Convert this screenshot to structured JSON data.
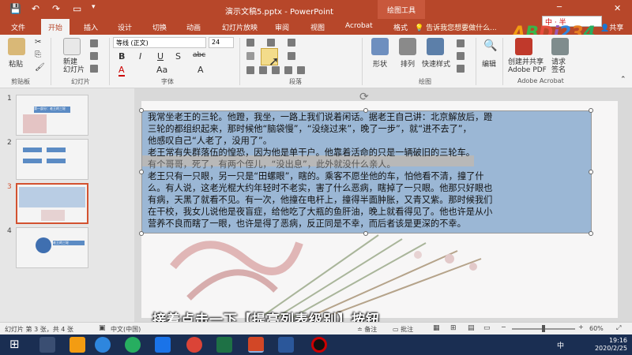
{
  "titlebar": {
    "title": "演示文稿5.pptx - PowerPoint",
    "context_tab": "绘图工具",
    "save_icon": "save-icon",
    "undo_icon": "undo-icon",
    "redo_icon": "redo-icon",
    "present_icon": "present-icon"
  },
  "tabs": [
    {
      "label": "文件"
    },
    {
      "label": "开始"
    },
    {
      "label": "插入"
    },
    {
      "label": "设计"
    },
    {
      "label": "切换"
    },
    {
      "label": "动画"
    },
    {
      "label": "幻灯片放映"
    },
    {
      "label": "审阅"
    },
    {
      "label": "视图"
    },
    {
      "label": "Acrobat"
    },
    {
      "label": "格式"
    }
  ],
  "tellme": "告诉我您想要做什么...",
  "share": "共享",
  "watermark": "ABDi234",
  "ime": "中 · 半",
  "ribbon": {
    "paste": "粘贴",
    "new_slide": "新建\n幻灯片",
    "font_name": "等线 (正文)",
    "font_size": "24",
    "shape": "形状",
    "arrange": "排列",
    "quick_styles": "快速样式",
    "edit": "编辑",
    "create_pdf": "创建并共享\nAdobe PDF",
    "request_sign": "请求\n签名",
    "groups": {
      "clipboard": "剪贴板",
      "slides": "幻灯片",
      "font": "字体",
      "paragraph": "段落",
      "drawing": "绘图",
      "acrobat": "Adobe Acrobat"
    },
    "bold": "B",
    "italic": "I",
    "underline": "U",
    "strike": "S",
    "abc": "abc"
  },
  "slides": [
    {
      "num": "1",
      "thumb_title": "第一部分：老王的三轮"
    },
    {
      "num": "2"
    },
    {
      "num": "3"
    },
    {
      "num": "4",
      "thumb_title": "老王的三轮"
    }
  ],
  "textbox": {
    "lines": [
      "我常坐老王的三轮。他蹬，我坐，一路上我们说着闲话。据老王自己讲：北京解放后，蹬",
      "三轮的都组织起来，那时候他“脑袋慢”，“没绕过来”，晚了一步”，就“进不去了”，",
      "他感叹自己“人老了，没用了”。",
      "老王常有失群落伍的惶恐，因为他是单干户。他靠着活命的只是一辆破旧的三轮车。",
      "有个哥哥，死了，有两个侄儿，“没出息”，此外就没什么亲人。",
      "老王只有一只眼，另一只是“田螺眼”，瞎的。乘客不愿坐他的车，怕他看不清，撞了什",
      "么。有人说，这老光棍大约年轻时不老实，害了什么恶病，瞎掉了一只眼。他那只好眼也",
      "有病，天黑了就看不见。有一次，他撞在电杆上，撞得半面肿胀，又青又紫。那时候我们",
      "在干校，我女儿说他是夜盲症，给他吃了大瓶的鱼肝油，晚上就看得见了。他也许是从小",
      "营养不良而瞎了一眼，也许是得了恶病，反正同是不幸，而后者该是更深的不幸。"
    ]
  },
  "subtitle": "接着点击一下【提高列表级别】按钮",
  "status": {
    "slide_info": "幻灯片 第 3 张，共 4 张",
    "language": "中文(中国)",
    "notes": "备注",
    "comments": "批注",
    "zoom": "60%"
  },
  "taskbar": {
    "time": "19:16",
    "date": "2020/2/25",
    "ime": "中"
  },
  "colors": {
    "accent": "#b7472a",
    "selection": "#9bb7d5",
    "highlight_line": "#b8b8b8"
  }
}
